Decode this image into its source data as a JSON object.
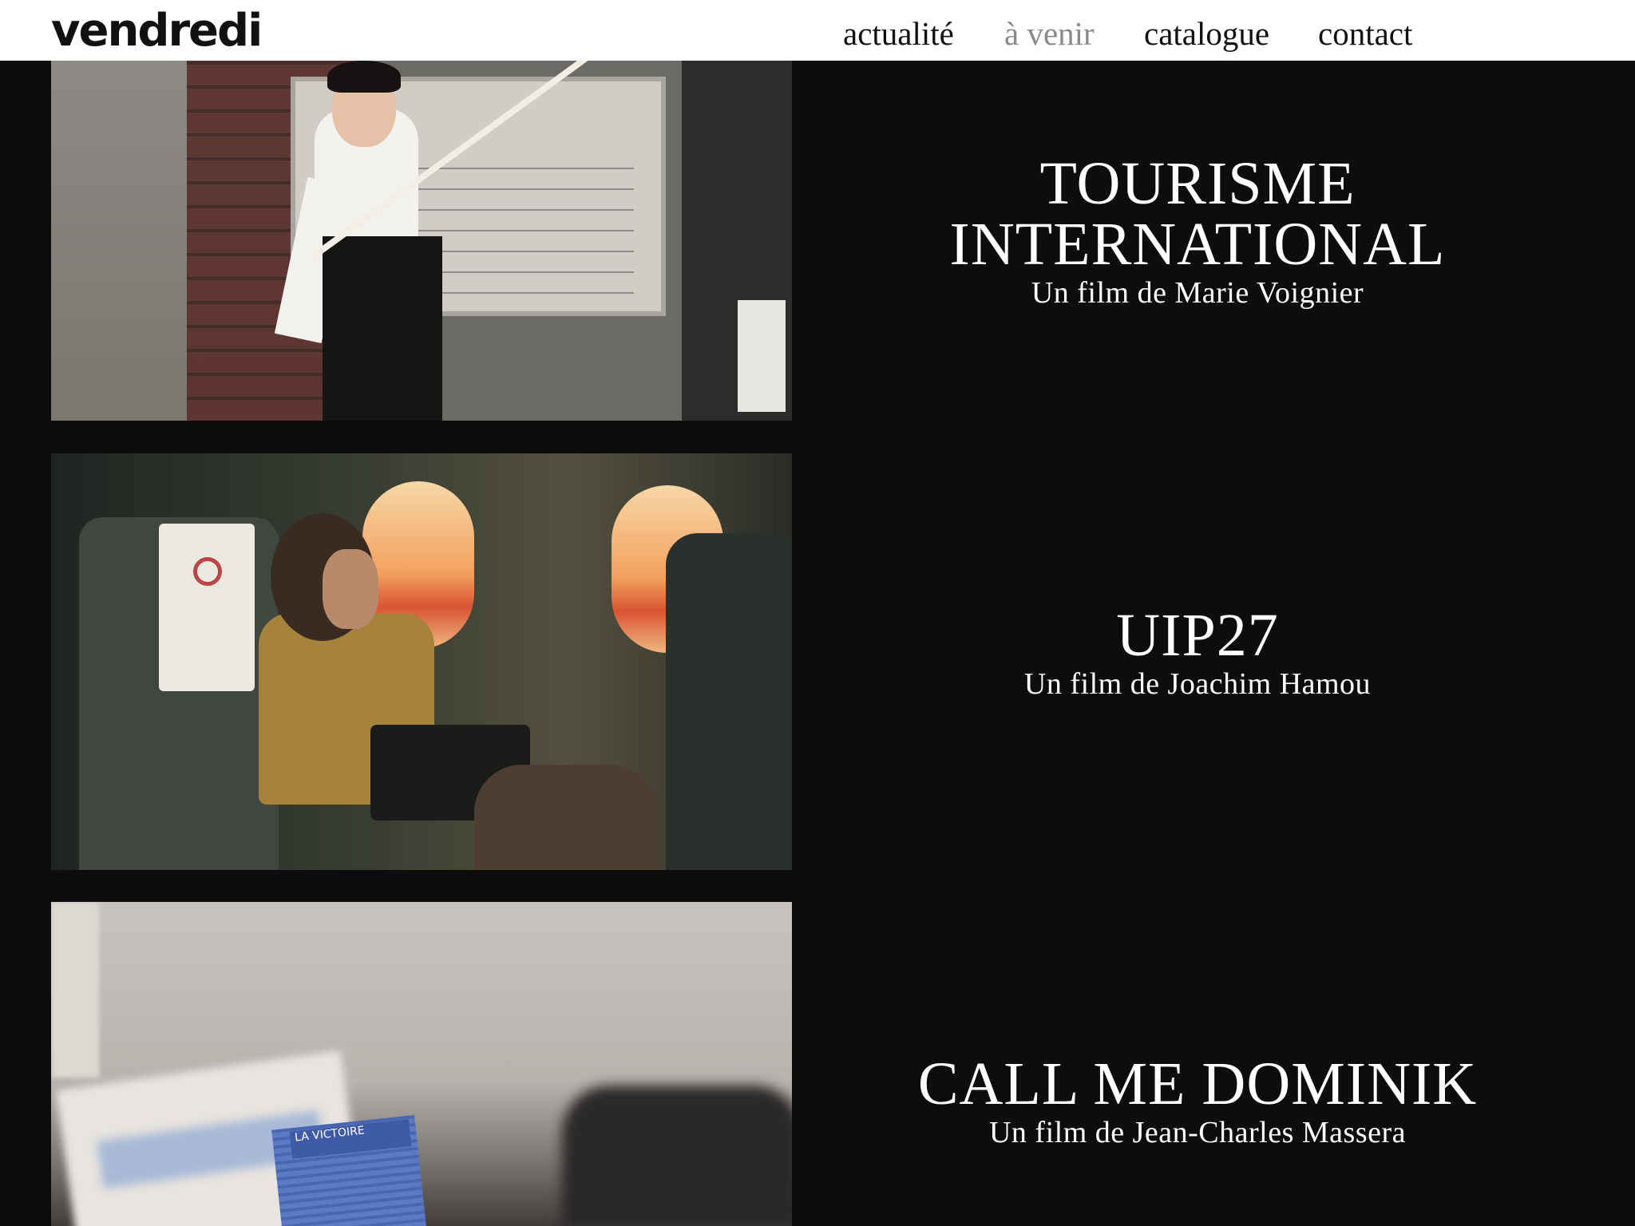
{
  "header": {
    "logo": "vendredi",
    "nav": [
      {
        "label": "actualité",
        "active": false
      },
      {
        "label": "à venir",
        "active": true
      },
      {
        "label": "catalogue",
        "active": false
      },
      {
        "label": "contact",
        "active": false
      }
    ]
  },
  "films": [
    {
      "title_line1": "TOURISME",
      "title_line2": "INTERNATIONAL",
      "subtitle": "Un film de Marie Voignier"
    },
    {
      "title_line1": "UIP27",
      "subtitle": "Un film de Joachim Hamou"
    },
    {
      "title_line1": "CALL ME DOMINIK",
      "subtitle": "Un film de Jean-Charles Massera",
      "image_card_text": "LA VICTOIRE"
    }
  ],
  "colors": {
    "page_background": "#0d0d0d",
    "header_background": "#ffffff",
    "nav_text": "#111111",
    "nav_active": "#8a8a8a",
    "film_text": "#ffffff"
  }
}
